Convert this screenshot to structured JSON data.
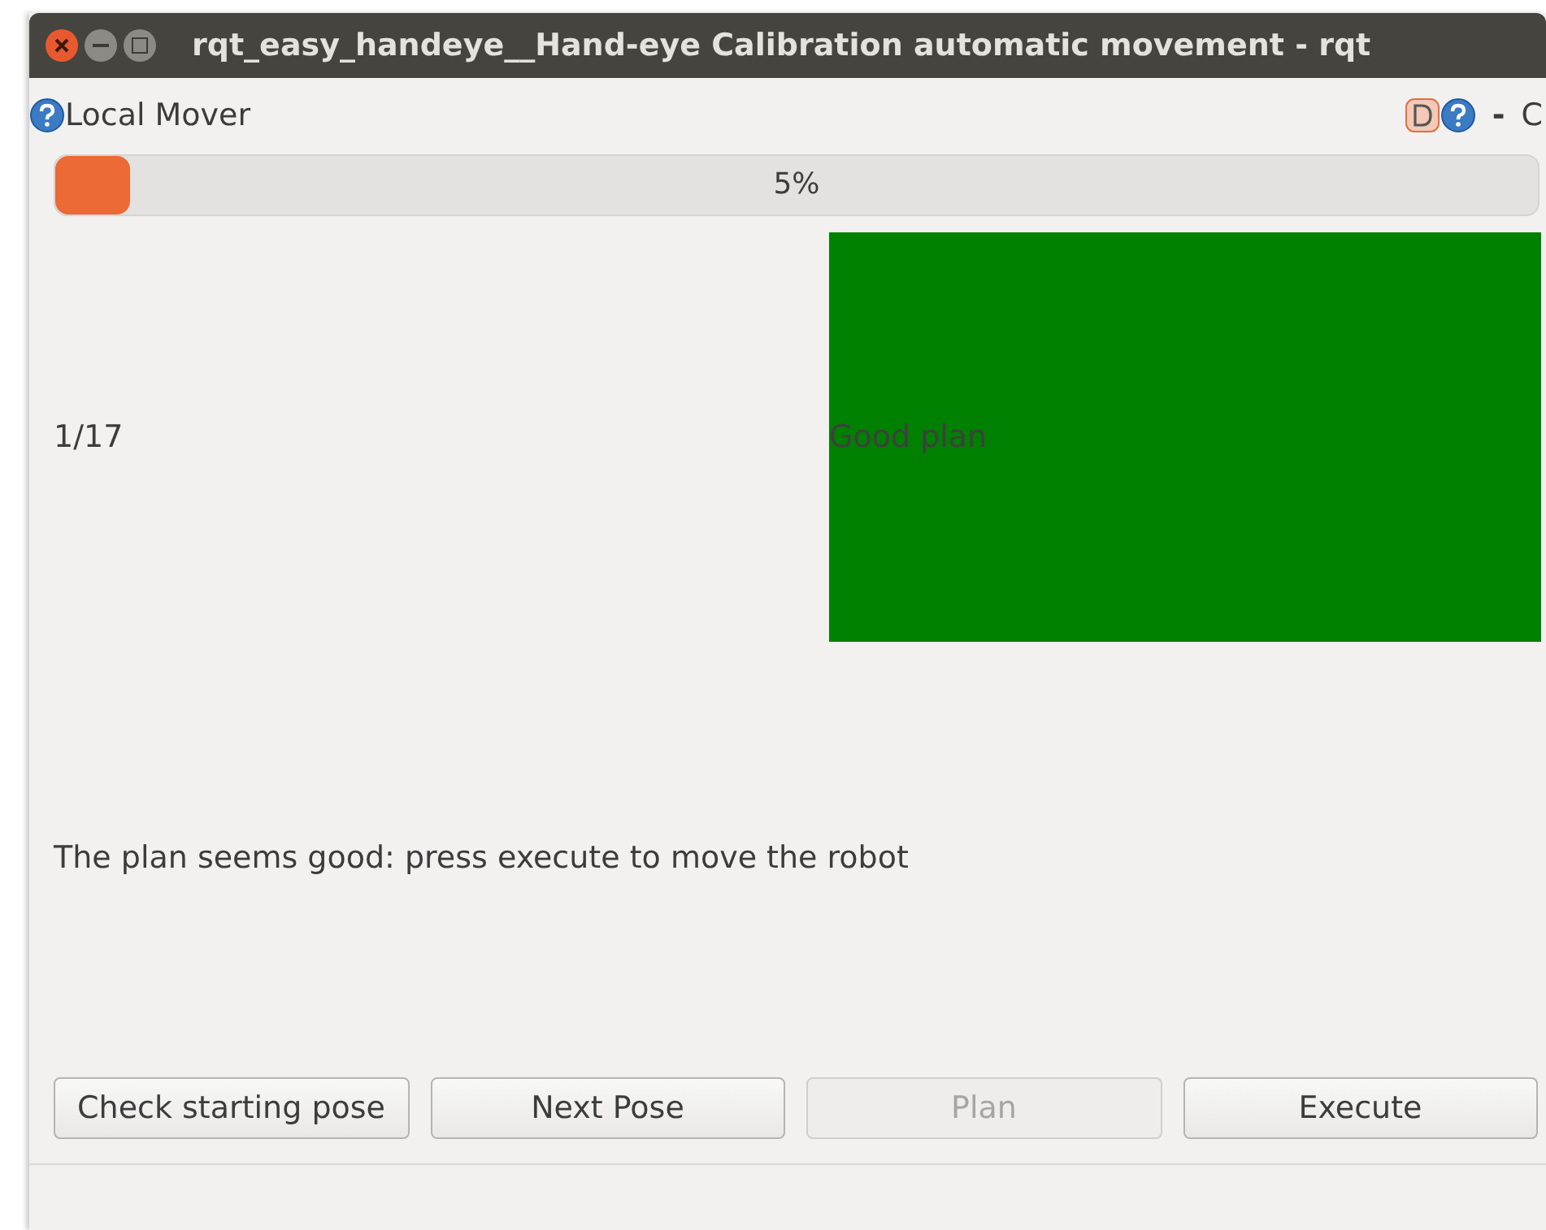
{
  "window": {
    "title": "rqt_easy_handeye__Hand-eye Calibration automatic movement - rqt"
  },
  "plugin_bar": {
    "title": "Local Mover",
    "dash": "-",
    "cut_label": "C"
  },
  "progress": {
    "level": 0.05,
    "label": "5%"
  },
  "counter": "1/17",
  "plan_status": {
    "label": "Good plan",
    "color": "#008000"
  },
  "message": "The plan seems good: press execute to move the robot",
  "buttons": [
    {
      "label": "Check starting pose",
      "disabled": false
    },
    {
      "label": "Next Pose",
      "disabled": false
    },
    {
      "label": "Plan",
      "disabled": true
    },
    {
      "label": "Execute",
      "disabled": false
    }
  ]
}
